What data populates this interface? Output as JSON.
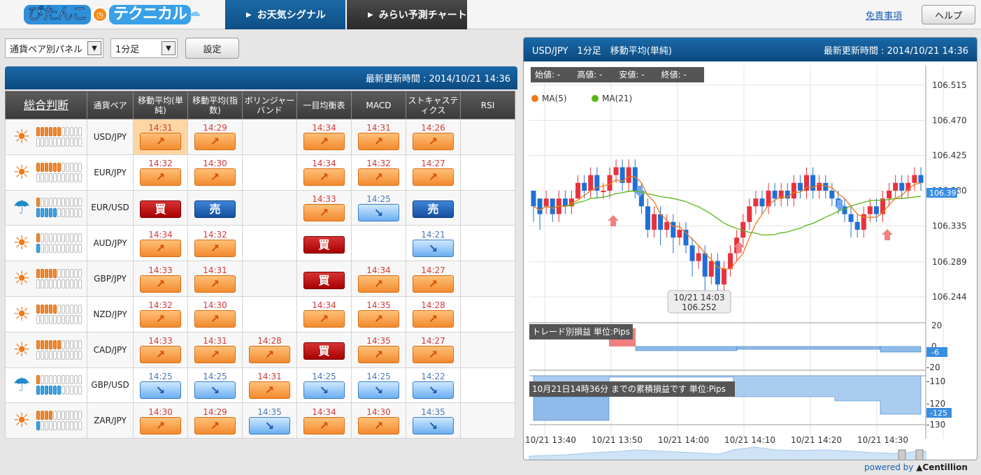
{
  "header": {
    "logo_part1": "ぴたんこ",
    "logo_part2": "テクニカル",
    "tab_weather": "お天気シグナル",
    "tab_chart": "みらい予測チャート",
    "disclaimer": "免責事項",
    "help": "ヘルプ"
  },
  "controls": {
    "panel_select": "通貨ペア別パネル",
    "timeframe_select": "1分足",
    "set_button": "設定"
  },
  "panel": {
    "updated": "最新更新時間 : 2014/10/21 14:36",
    "columns": [
      "総合判断",
      "通貨ペア",
      "移動平均(単純)",
      "移動平均(指数)",
      "ボリンジャーバンド",
      "一目均衡表",
      "MACD",
      "ストキャスティクス",
      "RSI"
    ],
    "rows": [
      {
        "weather": "sun",
        "orange": 6,
        "blue": 0,
        "pair": "USD/JPY",
        "signals": [
          {
            "t": "14:31",
            "c": "red",
            "s": "up",
            "hl": true
          },
          {
            "t": "14:29",
            "c": "red",
            "s": "up"
          },
          null,
          {
            "t": "14:34",
            "c": "red",
            "s": "up"
          },
          {
            "t": "14:31",
            "c": "red",
            "s": "up"
          },
          {
            "t": "14:26",
            "c": "red",
            "s": "up"
          },
          null
        ]
      },
      {
        "weather": "sun",
        "orange": 6,
        "blue": 0,
        "pair": "EUR/JPY",
        "signals": [
          {
            "t": "14:32",
            "c": "red",
            "s": "up"
          },
          {
            "t": "14:30",
            "c": "red",
            "s": "up"
          },
          null,
          {
            "t": "14:34",
            "c": "red",
            "s": "up"
          },
          {
            "t": "14:32",
            "c": "red",
            "s": "up"
          },
          {
            "t": "14:27",
            "c": "red",
            "s": "up"
          },
          null
        ]
      },
      {
        "weather": "umbrella",
        "orange": 1,
        "blue": 5,
        "pair": "EUR/USD",
        "signals": [
          {
            "t": "",
            "c": "red",
            "s": "buy"
          },
          {
            "t": "",
            "c": "red",
            "s": "sell"
          },
          null,
          {
            "t": "14:33",
            "c": "red",
            "s": "up"
          },
          {
            "t": "14:25",
            "c": "blue",
            "s": "down"
          },
          {
            "t": "",
            "c": "red",
            "s": "sell"
          },
          null
        ]
      },
      {
        "weather": "sun",
        "orange": 1,
        "blue": 1,
        "pair": "AUD/JPY",
        "signals": [
          {
            "t": "14:34",
            "c": "red",
            "s": "up"
          },
          {
            "t": "14:32",
            "c": "red",
            "s": "up"
          },
          null,
          {
            "t": "",
            "c": "red",
            "s": "buy"
          },
          null,
          {
            "t": "14:21",
            "c": "blue",
            "s": "down"
          },
          null
        ]
      },
      {
        "weather": "sun",
        "orange": 5,
        "blue": 0,
        "pair": "GBP/JPY",
        "signals": [
          {
            "t": "14:33",
            "c": "red",
            "s": "up"
          },
          {
            "t": "14:31",
            "c": "red",
            "s": "up"
          },
          null,
          {
            "t": "",
            "c": "red",
            "s": "buy"
          },
          {
            "t": "14:34",
            "c": "red",
            "s": "up"
          },
          {
            "t": "14:27",
            "c": "red",
            "s": "up"
          },
          null
        ]
      },
      {
        "weather": "sun",
        "orange": 5,
        "blue": 0,
        "pair": "NZD/JPY",
        "signals": [
          {
            "t": "14:32",
            "c": "red",
            "s": "up"
          },
          {
            "t": "14:30",
            "c": "red",
            "s": "up"
          },
          null,
          {
            "t": "14:34",
            "c": "red",
            "s": "up"
          },
          {
            "t": "14:35",
            "c": "red",
            "s": "up"
          },
          {
            "t": "14:28",
            "c": "red",
            "s": "up"
          },
          null
        ]
      },
      {
        "weather": "sun",
        "orange": 6,
        "blue": 0,
        "pair": "CAD/JPY",
        "signals": [
          {
            "t": "14:33",
            "c": "red",
            "s": "up"
          },
          {
            "t": "14:31",
            "c": "red",
            "s": "up"
          },
          {
            "t": "14:28",
            "c": "red",
            "s": "up"
          },
          {
            "t": "",
            "c": "red",
            "s": "buy"
          },
          {
            "t": "14:35",
            "c": "red",
            "s": "up"
          },
          {
            "t": "14:27",
            "c": "red",
            "s": "up"
          },
          null
        ]
      },
      {
        "weather": "umbrella",
        "orange": 1,
        "blue": 6,
        "pair": "GBP/USD",
        "signals": [
          {
            "t": "14:25",
            "c": "blue",
            "s": "down"
          },
          {
            "t": "14:25",
            "c": "blue",
            "s": "down"
          },
          {
            "t": "14:31",
            "c": "red",
            "s": "up"
          },
          {
            "t": "14:25",
            "c": "blue",
            "s": "down"
          },
          {
            "t": "14:25",
            "c": "blue",
            "s": "down"
          },
          {
            "t": "14:22",
            "c": "blue",
            "s": "down"
          },
          null
        ]
      },
      {
        "weather": "sun",
        "orange": 4,
        "blue": 1,
        "pair": "ZAR/JPY",
        "signals": [
          {
            "t": "14:30",
            "c": "red",
            "s": "up"
          },
          {
            "t": "14:29",
            "c": "red",
            "s": "up"
          },
          {
            "t": "14:35",
            "c": "blue",
            "s": "down"
          },
          {
            "t": "14:34",
            "c": "red",
            "s": "up"
          },
          {
            "t": "14:30",
            "c": "red",
            "s": "up"
          },
          {
            "t": "14:35",
            "c": "blue",
            "s": "down"
          },
          null
        ]
      }
    ],
    "buy_label": "買",
    "sell_label": "売"
  },
  "chart": {
    "title": "USD/JPY　1分足　移動平均(単純)",
    "updated": "最新更新時間 : 2014/10/21 14:36",
    "ohlc_label": "始値: -　　高値: -　　安値: -　　終値: -",
    "ma5": "MA(5)",
    "ma21": "MA(21)",
    "tooltip_time": "10/21 14:03",
    "tooltip_value": "106.252",
    "current_price": "106.393",
    "price_ticks": [
      "106.515",
      "106.470",
      "106.425",
      "106.380",
      "106.335",
      "106.289",
      "106.244"
    ],
    "trade_pl_label": "トレード別損益 単位:Pips",
    "trade_ticks": [
      "20",
      "0",
      "-20"
    ],
    "trade_current": "-6",
    "cum_label": "10月21日14時36分 までの累積損益です 単位:Pips",
    "cum_ticks": [
      "-110",
      "-120",
      "-130"
    ],
    "cum_current": "-125",
    "time_ticks": [
      "10/21 13:40",
      "10/21 13:50",
      "10/21 14:00",
      "10/21 14:10",
      "10/21 14:20",
      "10/21 14:30"
    ],
    "colors": {
      "up": "#e8323c",
      "down": "#1f6fd6",
      "ma5": "#f07a18",
      "ma21": "#5ab519"
    }
  },
  "chart_data": {
    "type": "line",
    "title": "USD/JPY　1分足　移動平均(単純)",
    "series": [
      {
        "name": "MA(5)"
      },
      {
        "name": "MA(21)"
      }
    ],
    "ylim": [
      106.22,
      106.54
    ],
    "x_range": [
      "10/21 13:40",
      "10/21 14:36"
    ],
    "candles": [
      [
        106.38,
        106.36,
        106.37,
        106.34
      ],
      [
        106.37,
        106.35,
        106.36,
        106.33
      ],
      [
        106.36,
        106.37,
        106.35,
        106.38
      ],
      [
        106.37,
        106.35,
        106.34,
        106.36
      ],
      [
        106.35,
        106.37,
        106.34,
        106.38
      ],
      [
        106.37,
        106.36,
        106.35,
        106.38
      ],
      [
        106.36,
        106.37,
        106.35,
        106.38
      ],
      [
        106.37,
        106.39,
        106.37,
        106.4
      ],
      [
        106.39,
        106.38,
        106.37,
        106.4
      ],
      [
        106.38,
        106.4,
        106.37,
        106.41
      ],
      [
        106.4,
        106.38,
        106.37,
        106.41
      ],
      [
        106.38,
        106.38,
        106.37,
        106.39
      ],
      [
        106.38,
        106.4,
        106.37,
        106.41
      ],
      [
        106.4,
        106.41,
        106.39,
        106.42
      ],
      [
        106.41,
        106.39,
        106.38,
        106.42
      ],
      [
        106.39,
        106.41,
        106.38,
        106.42
      ],
      [
        106.41,
        106.38,
        106.37,
        106.42
      ],
      [
        106.38,
        106.36,
        106.35,
        106.39
      ],
      [
        106.36,
        106.33,
        106.32,
        106.37
      ],
      [
        106.33,
        106.35,
        106.32,
        106.36
      ],
      [
        106.35,
        106.33,
        106.31,
        106.36
      ],
      [
        106.33,
        106.34,
        106.32,
        106.35
      ],
      [
        106.34,
        106.32,
        106.3,
        106.35
      ],
      [
        106.32,
        106.33,
        106.31,
        106.34
      ],
      [
        106.33,
        106.31,
        106.3,
        106.34
      ],
      [
        106.31,
        106.29,
        106.27,
        106.32
      ],
      [
        106.29,
        106.3,
        106.28,
        106.31
      ],
      [
        106.3,
        106.27,
        106.25,
        106.31
      ],
      [
        106.27,
        106.29,
        106.26,
        106.3
      ],
      [
        106.29,
        106.26,
        106.25,
        106.3
      ],
      [
        106.26,
        106.28,
        106.25,
        106.29
      ],
      [
        106.28,
        106.3,
        106.27,
        106.31
      ],
      [
        106.3,
        106.32,
        106.29,
        106.33
      ],
      [
        106.32,
        106.34,
        106.31,
        106.35
      ],
      [
        106.34,
        106.36,
        106.33,
        106.37
      ],
      [
        106.36,
        106.37,
        106.35,
        106.38
      ],
      [
        106.37,
        106.36,
        106.35,
        106.38
      ],
      [
        106.36,
        106.38,
        106.35,
        106.39
      ],
      [
        106.38,
        106.37,
        106.36,
        106.39
      ],
      [
        106.37,
        106.38,
        106.36,
        106.39
      ],
      [
        106.38,
        106.37,
        106.36,
        106.39
      ],
      [
        106.37,
        106.39,
        106.36,
        106.4
      ],
      [
        106.39,
        106.38,
        106.37,
        106.4
      ],
      [
        106.38,
        106.4,
        106.37,
        106.41
      ],
      [
        106.4,
        106.38,
        106.37,
        106.41
      ],
      [
        106.38,
        106.39,
        106.37,
        106.4
      ],
      [
        106.39,
        106.38,
        106.37,
        106.4
      ],
      [
        106.38,
        106.37,
        106.36,
        106.39
      ],
      [
        106.37,
        106.36,
        106.35,
        106.38
      ],
      [
        106.36,
        106.35,
        106.34,
        106.37
      ],
      [
        106.35,
        106.34,
        106.32,
        106.36
      ],
      [
        106.34,
        106.33,
        106.32,
        106.35
      ],
      [
        106.33,
        106.35,
        106.32,
        106.36
      ],
      [
        106.35,
        106.36,
        106.34,
        106.37
      ],
      [
        106.36,
        106.35,
        106.34,
        106.37
      ],
      [
        106.35,
        106.37,
        106.34,
        106.38
      ],
      [
        106.37,
        106.38,
        106.36,
        106.39
      ],
      [
        106.38,
        106.39,
        106.37,
        106.4
      ],
      [
        106.39,
        106.38,
        106.37,
        106.4
      ],
      [
        106.38,
        106.39,
        106.37,
        106.4
      ],
      [
        106.39,
        106.4,
        106.38,
        106.41
      ],
      [
        106.4,
        106.39,
        106.38,
        106.41
      ]
    ]
  }
}
